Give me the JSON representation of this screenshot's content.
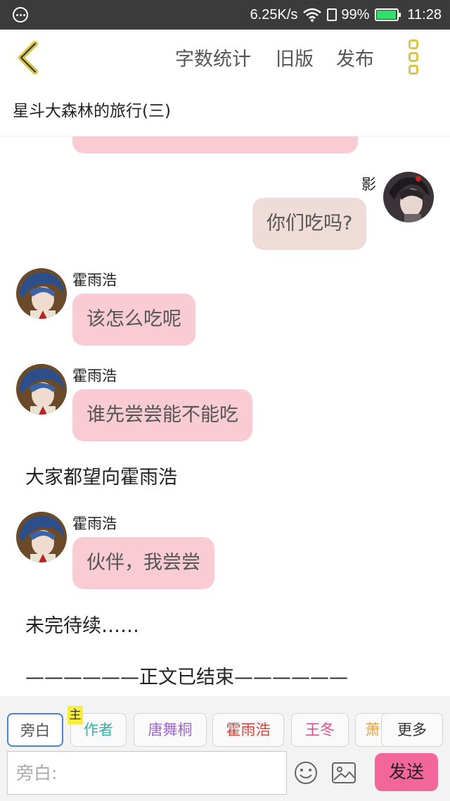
{
  "status_bar": {
    "speed": "6.25K/s",
    "battery": "99%",
    "time": "11:28"
  },
  "header": {
    "actions": [
      "字数统计",
      "旧版",
      "发布"
    ]
  },
  "document": {
    "title": "星斗大森林的旅行(三)"
  },
  "messages": [
    {
      "type": "right",
      "name": "影",
      "text": "你们吃吗?"
    },
    {
      "type": "left",
      "name": "霍雨浩",
      "text": "该怎么吃呢"
    },
    {
      "type": "left",
      "name": "霍雨浩",
      "text": "谁先尝尝能不能吃"
    },
    {
      "type": "narration",
      "text": "大家都望向霍雨浩"
    },
    {
      "type": "left",
      "name": "霍雨浩",
      "text": "伙伴，我尝尝"
    },
    {
      "type": "narration",
      "text": "未完待续……"
    },
    {
      "type": "narration",
      "text": "——————正文已结束——————"
    }
  ],
  "toolbar": {
    "characters": [
      {
        "label": "旁白",
        "color": "#555555"
      },
      {
        "label": "作者",
        "color": "#2fb3a8"
      },
      {
        "label": "唐舞桐",
        "color": "#a06ad0"
      },
      {
        "label": "霍雨浩",
        "color": "#d0453a"
      },
      {
        "label": "王冬",
        "color": "#e04a8c"
      },
      {
        "label": "萧",
        "color": "#e2a24a"
      }
    ],
    "main_badge": "主",
    "more_label": "更多",
    "input_placeholder": "旁白:",
    "send_label": "发送"
  },
  "colors": {
    "accent_yellow": "#d8c64a",
    "bubble_pink": "#f9ccd4",
    "bubble_gray": "#efdcd9",
    "send_pink": "#f2669a"
  }
}
